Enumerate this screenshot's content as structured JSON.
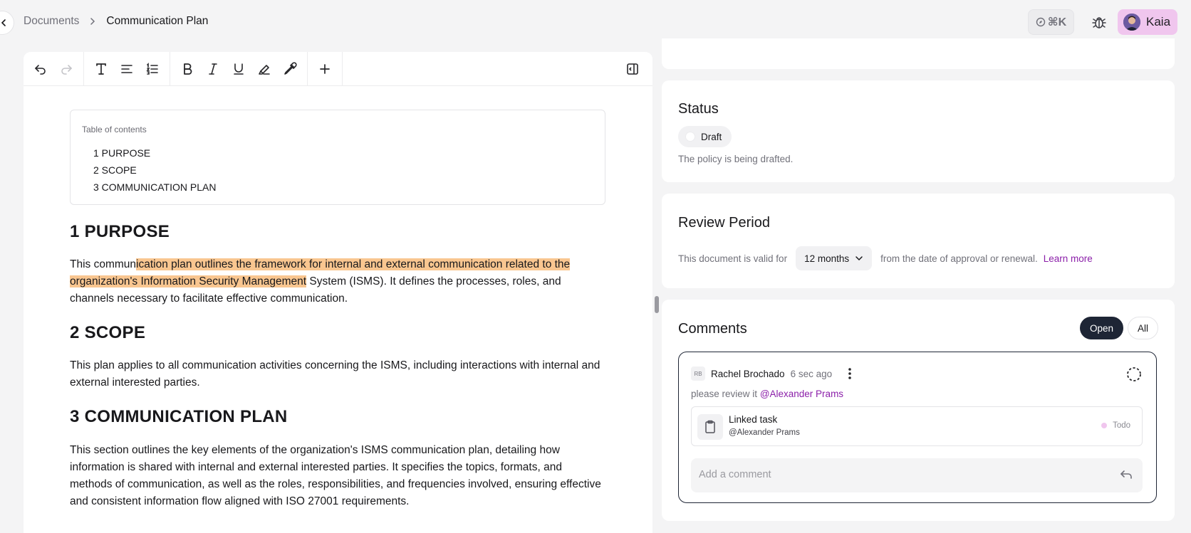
{
  "breadcrumb": {
    "root": "Documents",
    "current": "Communication Plan"
  },
  "header": {
    "shortcut": "⌘K",
    "user_name": "Kaia"
  },
  "toc": {
    "title": "Table of contents",
    "items": [
      "1 PURPOSE",
      "2 SCOPE",
      "3 COMMUNICATION PLAN"
    ]
  },
  "sections": {
    "purpose": {
      "heading": "1 PURPOSE",
      "text_before": "This commun",
      "text_highlight": "ication plan outlines the framework for internal and external communication related to the organization's Information Security Management",
      "text_after": " System (ISMS). It defines the processes, roles, and channels necessary to facilitate effective communication."
    },
    "scope": {
      "heading": "2 SCOPE",
      "text": "This plan applies to all communication activities concerning the ISMS, including interactions with internal and external interested parties."
    },
    "plan": {
      "heading": "3 COMMUNICATION PLAN",
      "text": "This section outlines the key elements of the organization's ISMS communication plan, detailing how information is shared with internal and external interested parties. It specifies the topics, formats, and methods of communication, as well as the roles, responsibilities, and frequencies involved, ensuring effective and consistent information flow aligned with ISO 27001 requirements."
    }
  },
  "status": {
    "title": "Status",
    "value": "Draft",
    "description": "The policy is being drafted."
  },
  "review": {
    "title": "Review Period",
    "prefix": "This document is valid for",
    "period": "12 months",
    "suffix": "from the date of approval or renewal.",
    "learn_more": "Learn more"
  },
  "comments": {
    "title": "Comments",
    "filters": [
      "Open",
      "All"
    ],
    "active_filter": "Open",
    "items": [
      {
        "initials": "RB",
        "author": "Rachel Brochado",
        "time": "6 sec ago",
        "text": "please review it",
        "mention": "@Alexander Prams",
        "linked_task": {
          "title": "Linked task",
          "assignee": "@Alexander Prams",
          "status": "Todo"
        }
      }
    ],
    "placeholder": "Add a comment"
  },
  "colors": {
    "highlight": "#f9c690",
    "accent": "#8b1fa9",
    "dark": "#1e2535",
    "user_chip": "#f0c6ee"
  }
}
